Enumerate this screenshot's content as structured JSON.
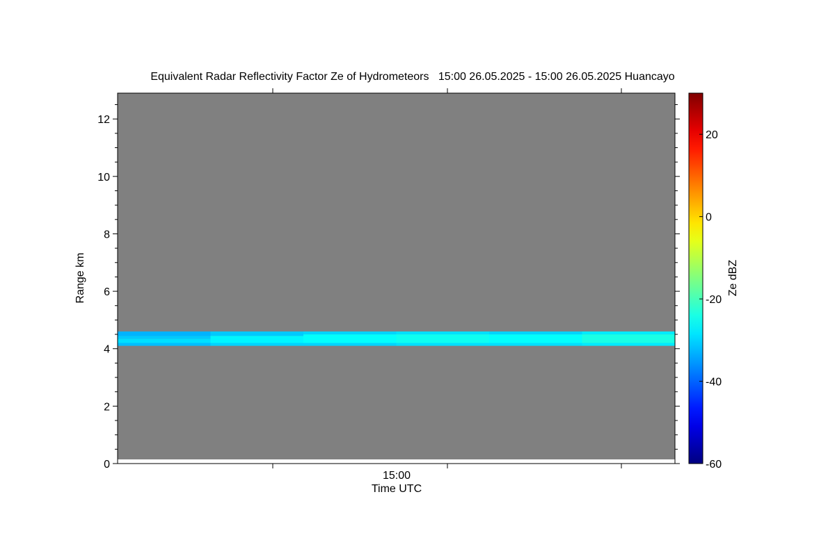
{
  "chart_data": {
    "type": "heatmap",
    "title": "Equivalent Radar Reflectivity Factor Ze of Hydrometeors   15:00 26.05.2025 - 15:00 26.05.2025 Huancayo",
    "xlabel": "Time UTC",
    "ylabel": "Range km",
    "x_tick_labels": [
      "15:00"
    ],
    "y_ticks": [
      0,
      2,
      4,
      6,
      8,
      10,
      12
    ],
    "ylim": [
      0,
      12.9
    ],
    "background_color": "#808080",
    "colorbar": {
      "label": "Ze dBZ",
      "range": [
        -60,
        30
      ],
      "ticks": [
        -60,
        -40,
        -20,
        0,
        20
      ],
      "colormap": "jet"
    },
    "bands": [
      {
        "x_segment": 0,
        "segments": [
          {
            "range_km": [
              4.1,
              4.2
            ],
            "ze_dbz": -32
          },
          {
            "range_km": [
              4.2,
              4.35
            ],
            "ze_dbz": -29
          },
          {
            "range_km": [
              4.35,
              4.45
            ],
            "ze_dbz": -31
          },
          {
            "range_km": [
              4.45,
              4.6
            ],
            "ze_dbz": -33
          }
        ]
      },
      {
        "x_segment": 1,
        "segments": [
          {
            "range_km": [
              4.1,
              4.2
            ],
            "ze_dbz": -30
          },
          {
            "range_km": [
              4.2,
              4.45
            ],
            "ze_dbz": -27
          },
          {
            "range_km": [
              4.45,
              4.6
            ],
            "ze_dbz": -31
          }
        ]
      },
      {
        "x_segment": 2,
        "segments": [
          {
            "range_km": [
              4.1,
              4.2
            ],
            "ze_dbz": -30
          },
          {
            "range_km": [
              4.2,
              4.5
            ],
            "ze_dbz": -26
          },
          {
            "range_km": [
              4.5,
              4.6
            ],
            "ze_dbz": -30
          }
        ]
      },
      {
        "x_segment": 3,
        "segments": [
          {
            "range_km": [
              4.1,
              4.2
            ],
            "ze_dbz": -29
          },
          {
            "range_km": [
              4.2,
              4.5
            ],
            "ze_dbz": -25
          },
          {
            "range_km": [
              4.5,
              4.6
            ],
            "ze_dbz": -29
          }
        ]
      },
      {
        "x_segment": 4,
        "segments": [
          {
            "range_km": [
              4.1,
              4.2
            ],
            "ze_dbz": -29
          },
          {
            "range_km": [
              4.2,
              4.5
            ],
            "ze_dbz": -26
          },
          {
            "range_km": [
              4.5,
              4.6
            ],
            "ze_dbz": -30
          }
        ]
      },
      {
        "x_segment": 5,
        "segments": [
          {
            "range_km": [
              4.1,
              4.2
            ],
            "ze_dbz": -28
          },
          {
            "range_km": [
              4.2,
              4.5
            ],
            "ze_dbz": -24
          },
          {
            "range_km": [
              4.5,
              4.6
            ],
            "ze_dbz": -28
          }
        ]
      }
    ]
  }
}
